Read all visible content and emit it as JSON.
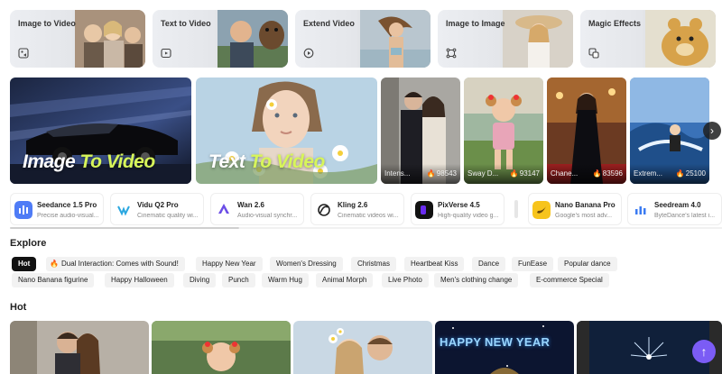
{
  "tools": [
    {
      "label": "Image to Video",
      "icon": "image-video-icon"
    },
    {
      "label": "Text to Video",
      "icon": "text-video-icon"
    },
    {
      "label": "Extend Video",
      "icon": "extend-video-icon"
    },
    {
      "label": "Image to Image",
      "icon": "image-image-icon"
    },
    {
      "label": "Magic Effects",
      "icon": "magic-effects-icon"
    }
  ],
  "banner": {
    "promo1": {
      "word1": "Image",
      "word2": "To Video"
    },
    "promo2": {
      "word1": "Text",
      "word2": "To Video"
    },
    "cards": [
      {
        "name": "Intens...",
        "likes": "98543"
      },
      {
        "name": "Sway D...",
        "likes": "93147"
      },
      {
        "name": "Chane...",
        "likes": "83596"
      },
      {
        "name": "Extrem...",
        "likes": "25100"
      }
    ],
    "next_icon": "›"
  },
  "models": [
    {
      "name": "Seedance 1.5 Pro",
      "desc": "Precise audio-visual...",
      "color": "#4f7cf6"
    },
    {
      "name": "Vidu Q2 Pro",
      "desc": "Cinematic quality wi...",
      "color": "#2aa7e0"
    },
    {
      "name": "Wan 2.6",
      "desc": "Audio-visual synchr...",
      "color": "#6b4de6"
    },
    {
      "name": "Kling 2.6",
      "desc": "Cinematic videos wi...",
      "color": "#222222"
    },
    {
      "name": "PixVerse 4.5",
      "desc": "High-quality video g...",
      "color": "#6a2cf0"
    },
    {
      "name": "Nano Banana Pro",
      "desc": "Google's most adv...",
      "color": "#f7c41c"
    },
    {
      "name": "Seedream 4.0",
      "desc": "ByteDance's latest i...",
      "color": "#3b7bf2"
    }
  ],
  "explore": {
    "title": "Explore",
    "row1": [
      "Hot",
      "Dual Interaction: Comes with Sound!",
      "Happy New Year",
      "Women's Dressing",
      "Christmas",
      "Heartbeat Kiss",
      "Dance",
      "FunEase",
      "Popular dance"
    ],
    "row2": [
      "Nano Banana figurine",
      "Happy Halloween",
      "Diving",
      "Punch",
      "Warm Hug",
      "Animal Morph",
      "Live Photo",
      "Men's clothing change",
      "E-commerce Special"
    ]
  },
  "hot": {
    "title": "Hot",
    "new_year_text": "HAPPY NEW YEAR",
    "up_icon": "↑"
  }
}
